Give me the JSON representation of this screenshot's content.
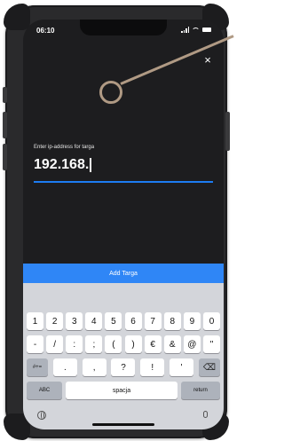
{
  "status_bar": {
    "time": "06:10"
  },
  "dialog": {
    "close_symbol": "×",
    "prompt": "Enter ip-address for targa",
    "ip_value": "192.168."
  },
  "action_bar": {
    "label": "Add Targa"
  },
  "keyboard": {
    "row1": [
      "1",
      "2",
      "3",
      "4",
      "5",
      "6",
      "7",
      "8",
      "9",
      "0"
    ],
    "row2": [
      "-",
      "/",
      ":",
      ";",
      "(",
      ")",
      "€",
      "&",
      "@",
      "\""
    ],
    "row3": {
      "mode_key": "#+=",
      "symbols": [
        ".",
        ",",
        "?",
        "!",
        "'"
      ],
      "delete_symbol": "⌫"
    },
    "row4": {
      "abc_key": "ABC",
      "space_key": "spacja",
      "return_key": "return"
    }
  },
  "colors": {
    "accent": "#2f86f6",
    "input_underline": "#1d7cf2",
    "callout": "#b09a84",
    "screen_bg": "#1d1d1f",
    "keyboard_bg": "#d3d5da"
  },
  "icons": [
    "close-icon",
    "signal-icon",
    "wifi-icon",
    "battery-icon",
    "globe-icon",
    "mic-icon",
    "backspace-icon"
  ]
}
